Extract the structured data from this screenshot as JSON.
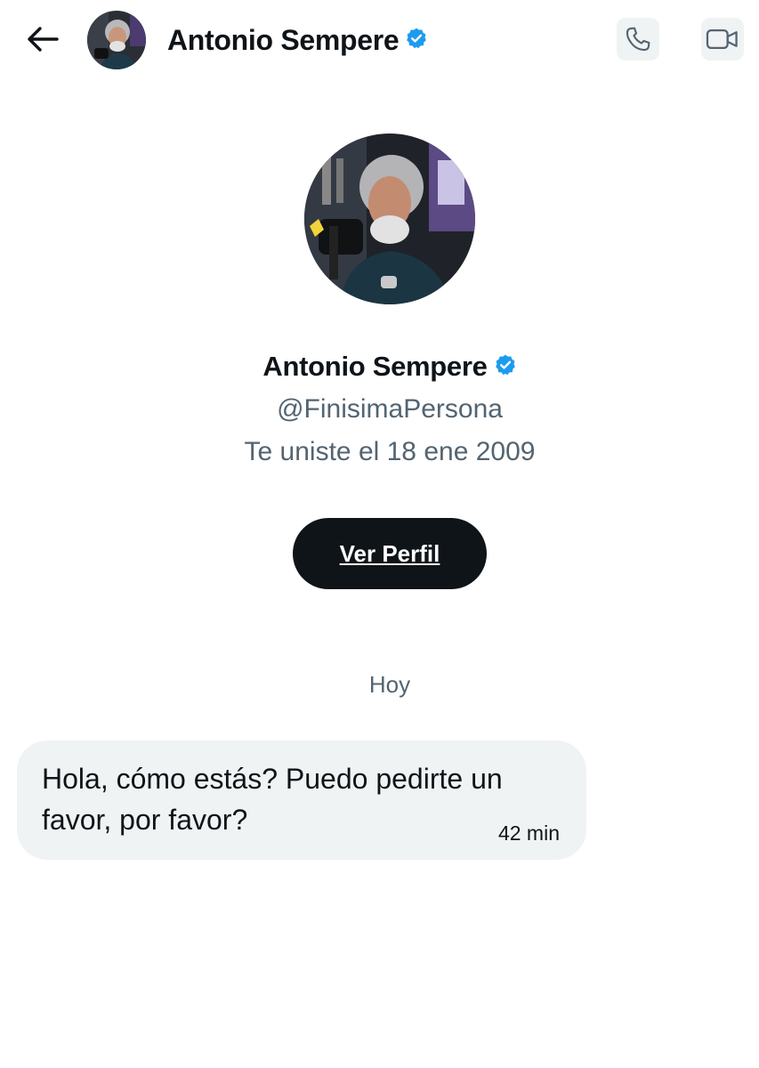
{
  "header": {
    "back_icon": "arrow-left-icon",
    "contact_name": "Antonio Sempere",
    "verified_icon": "verified-badge-icon",
    "call_icon": "phone-icon",
    "video_icon": "video-camera-icon"
  },
  "profile": {
    "name": "Antonio Sempere",
    "handle": "@FinisimaPersona",
    "joined": "Te uniste el 18 ene 2009",
    "view_profile_label": "Ver Perfil"
  },
  "conversation": {
    "day_label": "Hoy",
    "messages": [
      {
        "text": "Hola, cómo estás? Puedo pedirte un favor, por favor?",
        "time": "42 min"
      }
    ]
  },
  "colors": {
    "text_primary": "#0f1419",
    "text_secondary": "#536471",
    "verified_blue": "#1d9bf0",
    "bubble_bg": "#eff3f4",
    "button_bg": "#0f1419"
  }
}
